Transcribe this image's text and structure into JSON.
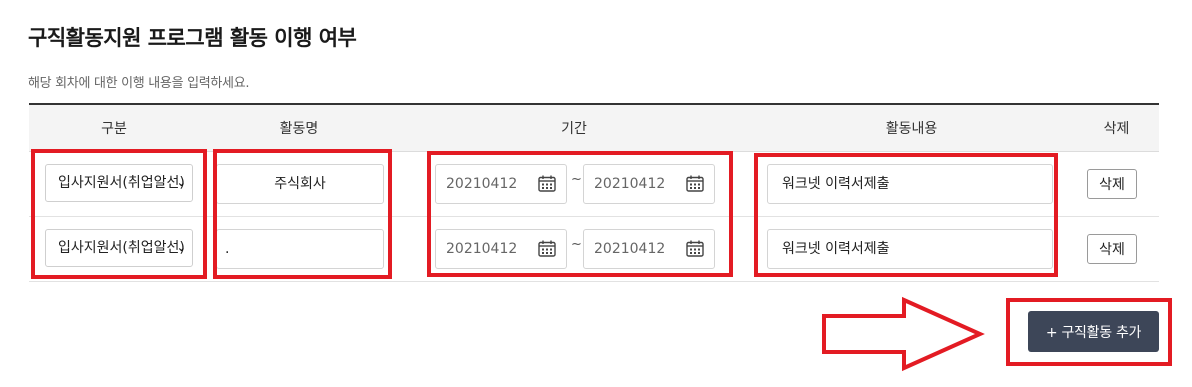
{
  "page": {
    "title": "구직활동지원 프로그램 활동 이행 여부",
    "description": "해당 회차에 대한 이행 내용을 입력하세요."
  },
  "table": {
    "headers": [
      "구분",
      "활동명",
      "기간",
      "활동내용",
      "삭제"
    ],
    "rows": [
      {
        "category": "입사지원서(취업알선)",
        "activity_name": "주식회사",
        "start_date": "20210412",
        "end_date": "20210412",
        "content": "워크넷 이력서제출",
        "delete_label": "삭제"
      },
      {
        "category": "입사지원서(취업알선)",
        "activity_name": ".",
        "start_date": "20210412",
        "end_date": "20210412",
        "content": "워크넷 이력서제출",
        "delete_label": "삭제"
      }
    ],
    "range_separator": "~"
  },
  "actions": {
    "add_label": "+ 구직활동 추가"
  },
  "colors": {
    "highlight": "#e31b23",
    "primary_button": "#3d4658"
  },
  "icons": [
    "calendar-icon",
    "chevron-down-icon",
    "arrow-right-icon"
  ]
}
